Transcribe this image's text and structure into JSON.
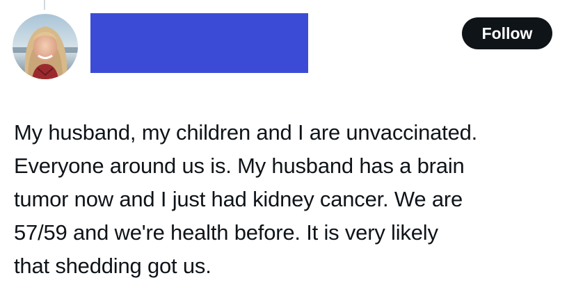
{
  "post": {
    "follow_label": "Follow",
    "text_lines": [
      "My husband, my children and I are unvaccinated.",
      "Everyone around us is. My husband has a brain",
      "tumor now and I just had kidney cancer. We are",
      "57/59 and we're health before. It is very likely",
      "that shedding got us."
    ]
  },
  "colors": {
    "redaction": "#3c4bd6",
    "follow_button_bg": "#0f1419",
    "text": "#0f1419"
  }
}
